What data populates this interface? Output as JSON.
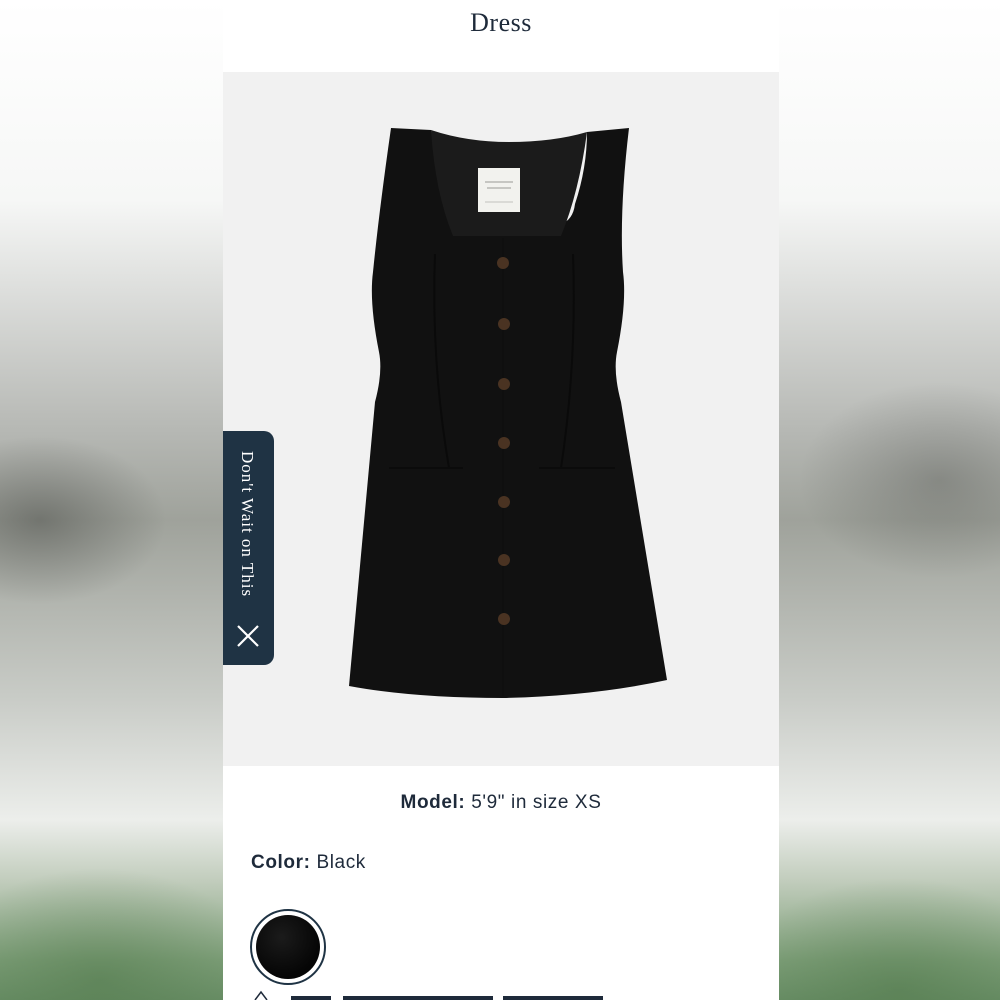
{
  "header": {
    "title": "Dress"
  },
  "product_image": {
    "subject": "black sleeveless button-front mini dress",
    "buttons": 7
  },
  "promo_tab": {
    "label": "Don't Wait on This",
    "close_icon": "close-icon"
  },
  "model_info": {
    "label": "Model:",
    "value": "5'9\" in size XS"
  },
  "color_info": {
    "label": "Color:",
    "value": "Black"
  },
  "swatches": [
    {
      "name": "Black",
      "color": "#0a0a0a",
      "selected": true
    }
  ],
  "colors": {
    "navy": "#1f3344",
    "text": "#1e2a3a",
    "image_bg": "#f1f1f1"
  }
}
